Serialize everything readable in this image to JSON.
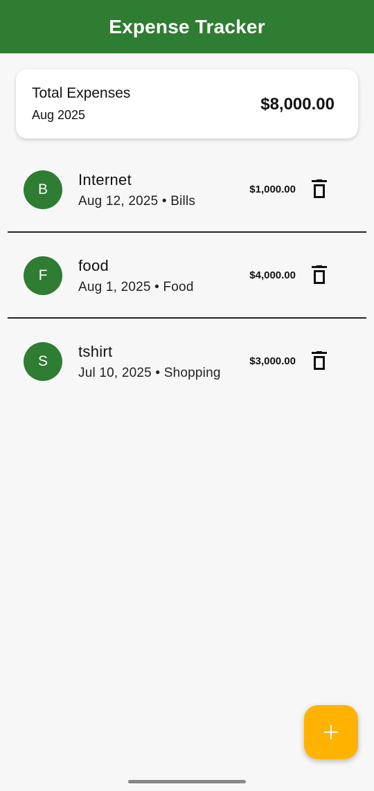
{
  "app_bar": {
    "title": "Expense Tracker"
  },
  "summary": {
    "title": "Total Expenses",
    "month": "Aug 2025",
    "total": "$8,000.00"
  },
  "expenses": [
    {
      "initial": "B",
      "name": "Internet",
      "meta": "Aug 12, 2025 • Bills",
      "amount": "$1,000.00",
      "delete_icon": "trash-icon"
    },
    {
      "initial": "F",
      "name": "food",
      "meta": "Aug 1, 2025 • Food",
      "amount": "$4,000.00",
      "delete_icon": "trash-icon"
    },
    {
      "initial": "S",
      "name": "tshirt",
      "meta": "Jul 10, 2025 • Shopping",
      "amount": "$3,000.00",
      "delete_icon": "trash-icon"
    }
  ],
  "fab": {
    "icon": "plus-icon"
  },
  "colors": {
    "primary": "#2e7d32",
    "accent": "#ffb300",
    "background": "#f7f7f7"
  }
}
